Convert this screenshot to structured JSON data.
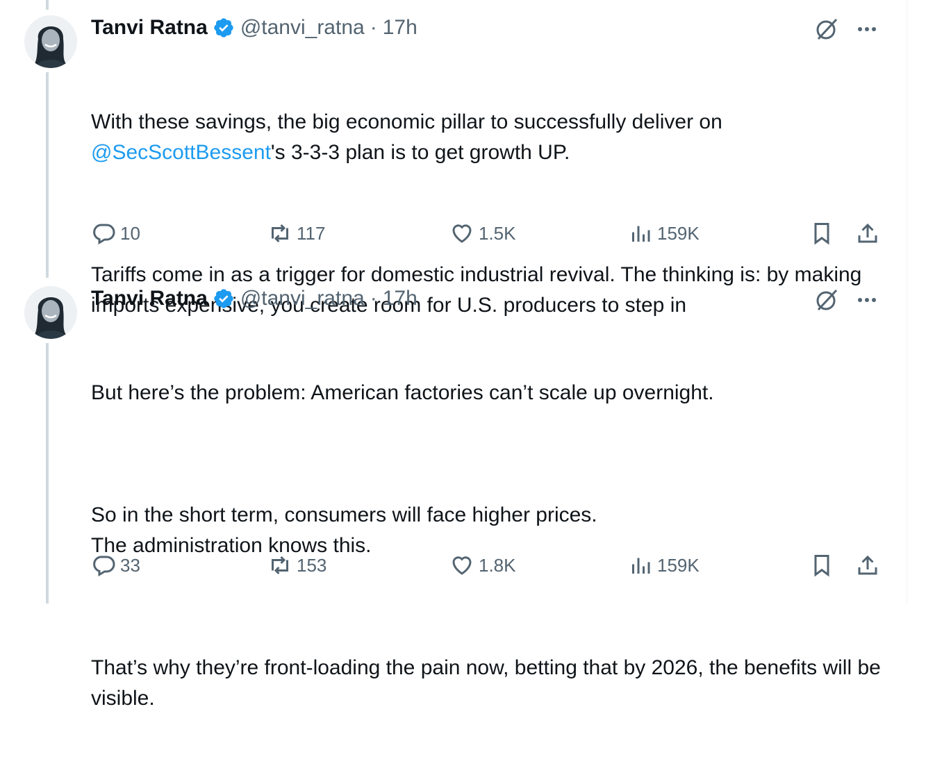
{
  "colors": {
    "text": "#0f1419",
    "secondary": "#536471",
    "link": "#1d9bf0",
    "verified": "#1d9bf0",
    "thread_line": "#cfd9de"
  },
  "tweets": [
    {
      "author_name": "Tanvi Ratna",
      "handle": "@tanvi_ratna",
      "separator": "·",
      "time": "17h",
      "line1": "With these savings, the big economic pillar to successfully deliver on",
      "mention": "@SecScottBessent",
      "line2_rest": "'s 3-3-3 plan is to get growth UP.",
      "para2": "Tariffs come in as a trigger for domestic industrial revival. The thinking is: by making imports expensive, you create room for U.S. producers to step in",
      "replies": "10",
      "reposts": "117",
      "likes": "1.5K",
      "views": "159K"
    },
    {
      "author_name": "Tanvi Ratna",
      "handle": "@tanvi_ratna",
      "separator": "·",
      "time": "17h",
      "para1": "But here’s the problem: American factories can’t scale up overnight.",
      "para2": "So in the short term, consumers will face higher prices.\nThe administration knows this.",
      "para3": "That’s why they’re front-loading the pain now, betting that by 2026, the benefits will be visible.",
      "replies": "33",
      "reposts": "153",
      "likes": "1.8K",
      "views": "159K"
    }
  ],
  "icons": [
    "verified-badge-icon",
    "grok-icon",
    "more-icon",
    "reply-icon",
    "repost-icon",
    "like-icon",
    "views-icon",
    "bookmark-icon",
    "share-icon"
  ]
}
